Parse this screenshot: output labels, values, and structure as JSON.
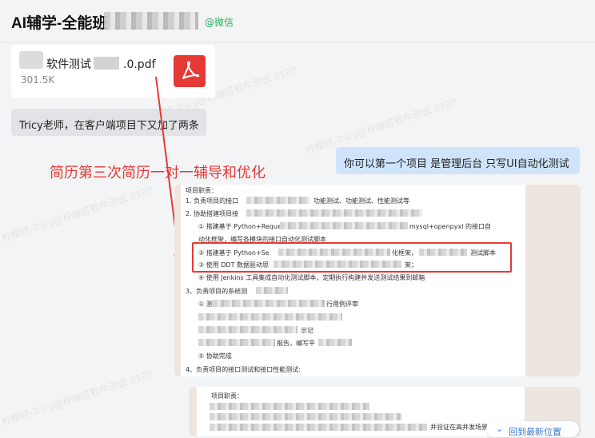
{
  "header": {
    "title": "AI辅学-全能班",
    "wechat_tag": "@微信"
  },
  "file_card": {
    "name": "软件测试",
    "name_suffix": ".0.pdf",
    "size": "301.5K",
    "icon": "pdf-icon"
  },
  "messages": {
    "left_1": "Tricy老师，在客户端项目下又加了两条",
    "right_1": "你可以第一个项目 是管理后台 只写UI自动化测试"
  },
  "annotation": "简历第三次简历一对一辅导和优化",
  "resume": {
    "section_heading": "项目职责：",
    "lines": [
      "1. 负责项目的接口",
      "功能测试、功能测试、性能测试等",
      "2. 协助搭建项目接",
      "① 搭建基于 Python+Request",
      "mysql+openpyxl 的接口自",
      "动化框架，编写各模块的接口自动化测试脚本",
      "② 搭建基于 Python+Se",
      "化框架，",
      "测试脚本",
      "③ 使用 DDT 数据驱动思",
      "架；",
      "④ 使用 Jenkins 工具集成自动化测试脚本，定期执行构建并发送测试结果到邮箱",
      "3、负责项目的系统测",
      "① 测",
      "行用例评审",
      "示记",
      "报告，编写平",
      "⑤ 协助完成",
      "4、负责项目的接口测试和接口性能测试:"
    ],
    "doc2_heading": "项目职责：",
    "doc2_tail": "并验证在高并发场景"
  },
  "back_button": {
    "label": "回到最新位置",
    "icon": "chevron-down-icon"
  },
  "watermark": "柠檬班-Tricy@柠檬班软件测试 0107",
  "colors": {
    "accent_red": "#e53935",
    "wechat_green": "#21b35a",
    "bubble_blue": "#cfe4fb",
    "link_blue": "#3a7bd5"
  }
}
